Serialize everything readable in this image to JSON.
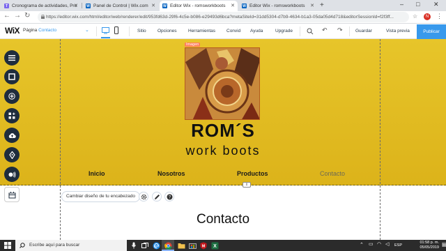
{
  "browser": {
    "tabs": [
      {
        "title": "Cronograma de actividades, Pro",
        "favicon": "T",
        "color": "#7b68ee",
        "active": false
      },
      {
        "title": "Panel de Control | Wix.com",
        "favicon": "W",
        "color": "#0a66c2",
        "active": false
      },
      {
        "title": "Editor Wix - romsworkboots",
        "favicon": "W",
        "color": "#0a66c2",
        "active": true
      },
      {
        "title": "Editor Wix - romsworkboots",
        "favicon": "W",
        "color": "#0a66c2",
        "active": false
      }
    ],
    "new_tab": "+",
    "url": "https://editor.wix.com/html/editor/web/renderer/edit/953fd63d-29f6-4c5e-b086-e29493d6bca?metaSiteId=31dd5304-d7b9-4634-b1a3-05da05d4d718&editorSessionId=f2f3ff...",
    "profile_initial": "N",
    "window_controls": {
      "minimize": "–",
      "maximize": "□",
      "close": "✕"
    }
  },
  "wix": {
    "logo": "WiX",
    "page_label": "Página",
    "page_value": "Contacto",
    "menu": [
      "Sitio",
      "Opciones",
      "Herramientas",
      "Convid",
      "Ayuda",
      "Upgrade"
    ],
    "save": "Guardar",
    "preview": "Vista previa",
    "publish": "Publicar"
  },
  "site": {
    "image_tag": "Imagen",
    "brand": "ROM´S",
    "tagline": "work boots",
    "nav": [
      "Inicio",
      "Nosotros",
      "Productos",
      "Contacto"
    ],
    "current_nav": "Contacto",
    "change_header": "Cambiar diseño de tu encabezado",
    "page_heading": "Contacto"
  },
  "taskbar": {
    "search_placeholder": "Escribe aquí para buscar",
    "language": "ESP",
    "time": "01:58 p. m.",
    "date": "05/05/2019"
  },
  "colors": {
    "header_gold": "#e0bb22",
    "wix_blue": "#3899ec",
    "tool_dark": "#1f2d3d"
  }
}
